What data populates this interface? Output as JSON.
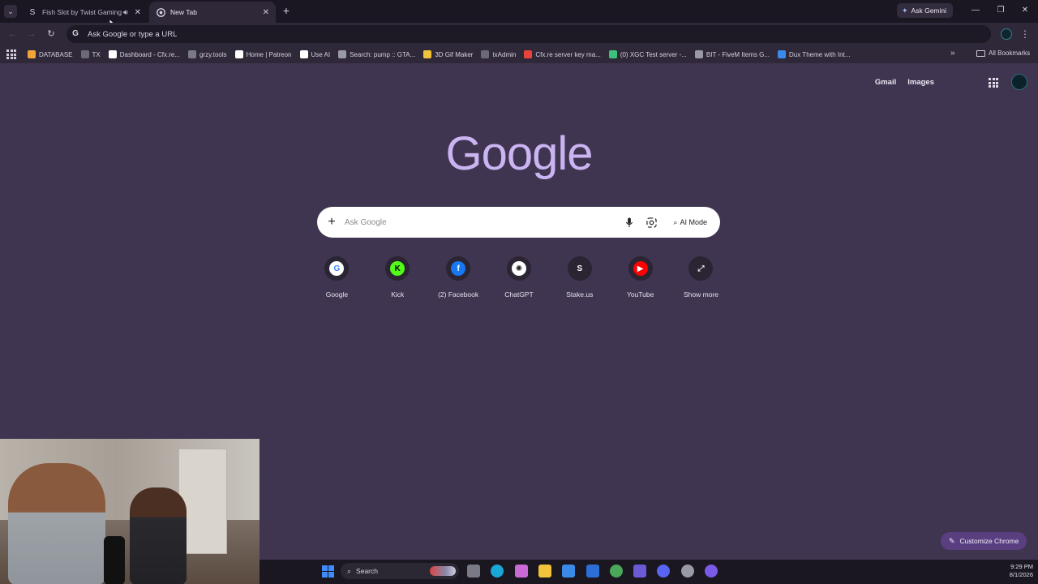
{
  "tabs": [
    {
      "title": "Fish Slot by Twist Gaming -",
      "favicon": "stake-s-icon",
      "active": false,
      "audio": true
    },
    {
      "title": "New Tab",
      "favicon": "chrome-icon",
      "active": true
    }
  ],
  "ask_gemini": "Ask Gemini",
  "omnibox": {
    "text": "Ask Google or type a URL"
  },
  "bookmarks": [
    {
      "label": "DATABASE",
      "color": "#f2a33a"
    },
    {
      "label": "TX",
      "color": "#6a6a78"
    },
    {
      "label": "Dashboard - Cfx.re...",
      "color": "#ffffff"
    },
    {
      "label": "grzy.tools",
      "color": "#7a7a86"
    },
    {
      "label": "Home | Patreon",
      "color": "#ffffff"
    },
    {
      "label": "Use AI",
      "color": "#ffffff"
    },
    {
      "label": "Search: pump :: GTA...",
      "color": "#9a9aa6"
    },
    {
      "label": "3D Gif Maker",
      "color": "#f2c33a"
    },
    {
      "label": "txAdmin",
      "color": "#6a6a78"
    },
    {
      "label": "Cfx.re server key ma...",
      "color": "#e8433a"
    },
    {
      "label": "(0) XGC Test server -...",
      "color": "#3ac27a"
    },
    {
      "label": "BIT - FiveM Items G...",
      "color": "#9a9aa6"
    },
    {
      "label": "Dux Theme with Int...",
      "color": "#3a8be8"
    }
  ],
  "all_bookmarks": "All Bookmarks",
  "ntp": {
    "gmail": "Gmail",
    "images": "Images",
    "logo": "Google",
    "search_placeholder": "Ask Google",
    "ai_mode": "AI Mode",
    "customize": "Customize Chrome"
  },
  "shortcuts": [
    {
      "label": "Google",
      "icon": "google-icon",
      "bg": "#ffffff",
      "glyph": "G",
      "fg": "#4285f4"
    },
    {
      "label": "Kick",
      "icon": "kick-icon",
      "bg": "#53fc18",
      "glyph": "K",
      "fg": "#000000"
    },
    {
      "label": "(2) Facebook",
      "icon": "facebook-icon",
      "bg": "#1877f2",
      "glyph": "f",
      "fg": "#ffffff"
    },
    {
      "label": "ChatGPT",
      "icon": "chatgpt-icon",
      "bg": "#ffffff",
      "glyph": "✺",
      "fg": "#202124"
    },
    {
      "label": "Stake.us",
      "icon": "stake-icon",
      "bg": "#2a2433",
      "glyph": "S",
      "fg": "#ffffff"
    },
    {
      "label": "YouTube",
      "icon": "youtube-icon",
      "bg": "#ff0000",
      "glyph": "▶",
      "fg": "#ffffff"
    },
    {
      "label": "Show more",
      "icon": "expand-icon",
      "bg": "#2a2433",
      "glyph": "⤢",
      "fg": "#e6e2ec"
    }
  ],
  "taskbar": {
    "search": "Search",
    "time": "9:29 PM",
    "date": "8/1/2026",
    "apps": [
      {
        "name": "file-explorer-icon",
        "color": "#7a7a86"
      },
      {
        "name": "edge-icon",
        "color": "#1aa6d6"
      },
      {
        "name": "copilot-icon",
        "color": "#c86ad6"
      },
      {
        "name": "folder-icon",
        "color": "#f2c33a"
      },
      {
        "name": "store-icon",
        "color": "#3a8be8"
      },
      {
        "name": "outlook-icon",
        "color": "#2a6ed6"
      },
      {
        "name": "chrome-icon",
        "color": "#4aa85a"
      },
      {
        "name": "teams-icon",
        "color": "#6a5ad6"
      },
      {
        "name": "discord-icon",
        "color": "#5865f2"
      },
      {
        "name": "gear-app-icon",
        "color": "#9a9aa6"
      },
      {
        "name": "circle-app-icon",
        "color": "#7a5ae8"
      }
    ]
  }
}
